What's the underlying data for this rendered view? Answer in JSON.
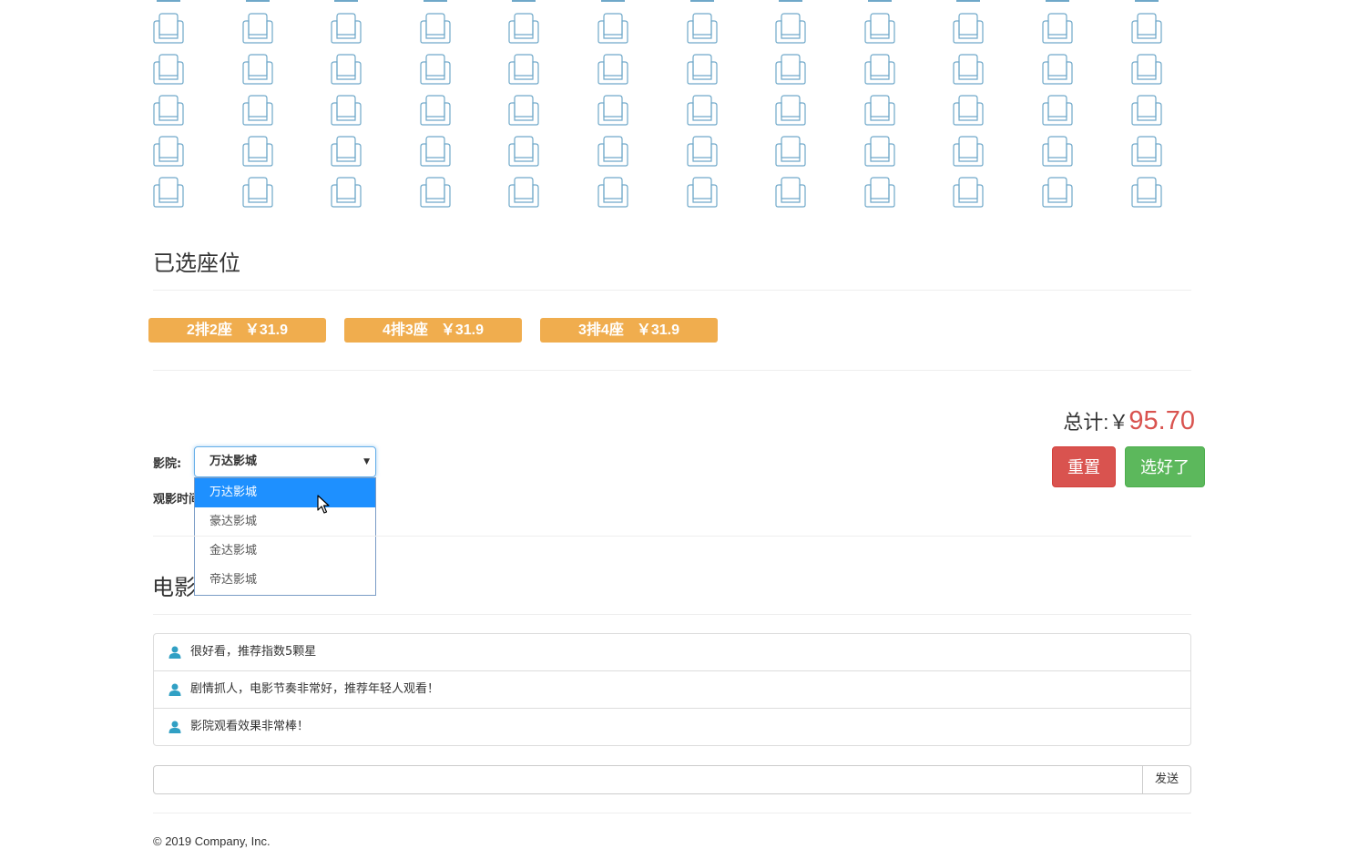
{
  "seats": {
    "visible_rows": 5,
    "seats_per_row": 12,
    "seat_color": "#6fa8c9",
    "seat_icon": "armchair-icon"
  },
  "selected_section": {
    "title": "已选座位",
    "tickets": [
      {
        "seat": "2排2座",
        "price": "￥31.9"
      },
      {
        "seat": "4排3座",
        "price": "￥31.9"
      },
      {
        "seat": "3排4座",
        "price": "￥31.9"
      }
    ],
    "tag_color": "#f0ad4e"
  },
  "summary": {
    "total_label": "总计:￥",
    "total_value": "95.70",
    "reset_label": "重置",
    "confirm_label": "选好了",
    "reset_color": "#d9534f",
    "confirm_color": "#5cb85c"
  },
  "form": {
    "cinema_label": "影院:",
    "cinema_selected": "万达影城",
    "cinema_options": [
      "万达影城",
      "豪达影城",
      "金达影城",
      "帝达影城"
    ],
    "time_label_visible": "观影时间"
  },
  "comments_section": {
    "title_visible": "电影",
    "comments": [
      "很好看，推荐指数5颗星",
      "剧情抓人，电影节奏非常好，推荐年轻人观看！",
      "影院观看效果非常棒！"
    ],
    "user_icon": "user-icon",
    "input_value": "",
    "send_label": "发送"
  },
  "footer": {
    "text": "© 2019 Company, Inc."
  }
}
